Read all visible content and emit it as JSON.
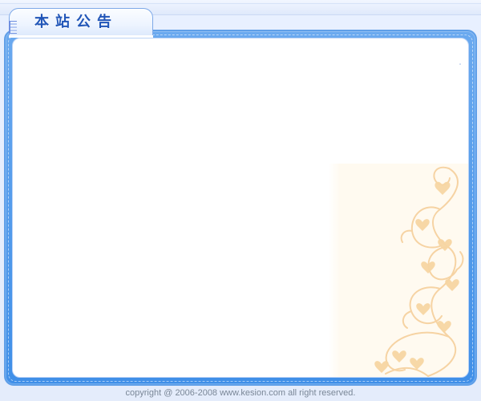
{
  "window": {
    "section_title": "本站公告"
  },
  "footer": {
    "copyright": "copyright @ 2006-2008 www.kesion.com all right reserved."
  },
  "icons": {
    "tab_marker": "tab-stripe-icon",
    "decoration": "floral-vine-icon"
  },
  "colors": {
    "frame_blue": "#4a95ea",
    "tab_text": "#2156b8",
    "decoration": "#f7d6a3",
    "footer_text": "#7a8797"
  }
}
